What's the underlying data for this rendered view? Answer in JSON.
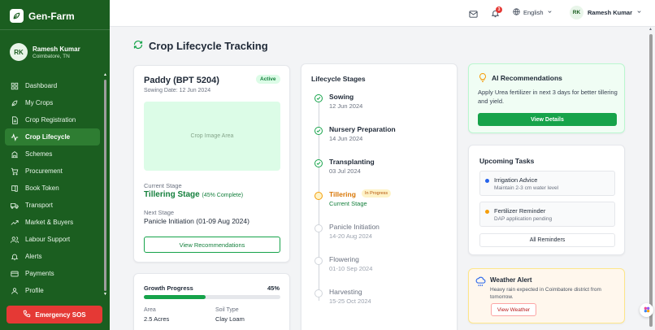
{
  "app": {
    "name": "Gen-Farm"
  },
  "user": {
    "initials": "RK",
    "name": "Ramesh Kumar",
    "location": "Coimbatore, TN"
  },
  "nav": [
    {
      "label": "Dashboard",
      "icon": "dashboard-icon",
      "active": false
    },
    {
      "label": "My Crops",
      "icon": "leaf-icon",
      "active": false
    },
    {
      "label": "Crop Registration",
      "icon": "document-icon",
      "active": false
    },
    {
      "label": "Crop Lifecycle",
      "icon": "activity-icon",
      "active": true
    },
    {
      "label": "Schemes",
      "icon": "building-icon",
      "active": false
    },
    {
      "label": "Procurement",
      "icon": "cart-icon",
      "active": false
    },
    {
      "label": "Book Token",
      "icon": "book-icon",
      "active": false
    },
    {
      "label": "Transport",
      "icon": "truck-icon",
      "active": false
    },
    {
      "label": "Market & Buyers",
      "icon": "trending-up-icon",
      "active": false
    },
    {
      "label": "Labour Support",
      "icon": "users-icon",
      "active": false
    },
    {
      "label": "Alerts",
      "icon": "bell-icon",
      "active": false
    },
    {
      "label": "Payments",
      "icon": "card-icon",
      "active": false
    },
    {
      "label": "Profile",
      "icon": "user-icon",
      "active": false
    }
  ],
  "sos": {
    "label": "Emergency SOS"
  },
  "topbar": {
    "notif_count": "3",
    "language": "English",
    "user_initials": "RK",
    "user_name": "Ramesh Kumar"
  },
  "page": {
    "title": "Crop Lifecycle Tracking"
  },
  "crop": {
    "name": "Paddy (BPT 5204)",
    "status": "Active",
    "sowing_date": "Sowing Date: 12 Jun 2024",
    "image_placeholder": "Crop Image Area",
    "current_stage_label": "Current Stage",
    "current_stage": "Tillering Stage",
    "current_stage_pct": "(45% Complete)",
    "next_stage_label": "Next Stage",
    "next_stage": "Panicle Initiation (01-09 Aug 2024)",
    "button": "View Recommendations"
  },
  "growth": {
    "title": "Growth Progress",
    "percent_text": "45%",
    "percent": 45,
    "area_label": "Area",
    "area": "2.5 Acres",
    "soil_label": "Soil Type",
    "soil": "Clay Loam"
  },
  "lifecycle": {
    "title": "Lifecycle Stages",
    "stages": [
      {
        "name": "Sowing",
        "date": "12 Jun 2024",
        "status": "done"
      },
      {
        "name": "Nursery Preparation",
        "date": "14 Jun 2024",
        "status": "done"
      },
      {
        "name": "Transplanting",
        "date": "03 Jul 2024",
        "status": "done"
      },
      {
        "name": "Tillering",
        "date": "Current Stage",
        "status": "current",
        "badge": "In Progress"
      },
      {
        "name": "Panicle Initiation",
        "date": "14-20 Aug 2024",
        "status": "pending"
      },
      {
        "name": "Flowering",
        "date": "01-10 Sep 2024",
        "status": "pending"
      },
      {
        "name": "Harvesting",
        "date": "15-25 Oct 2024",
        "status": "pending"
      }
    ]
  },
  "ai": {
    "title": "AI Recommendations",
    "text": "Apply Urea fertilizer in next 3 days for better tillering and yield.",
    "button": "View Details"
  },
  "tasks": {
    "title": "Upcoming Tasks",
    "items": [
      {
        "name": "Irrigation Advice",
        "detail": "Maintain 2-3 cm water level",
        "color": "#2563eb"
      },
      {
        "name": "Fertilizer Reminder",
        "detail": "DAP application pending",
        "color": "#f59e0b"
      }
    ],
    "button": "All Reminders"
  },
  "weather": {
    "title": "Weather Alert",
    "text": "Heavy rain expected in Coimbatore district from tomorrow.",
    "button": "View Weather"
  },
  "colors": {
    "sidebar": "#1b5e20",
    "accent": "#16a34a",
    "sos": "#e53935",
    "warning": "#f59e0b"
  }
}
